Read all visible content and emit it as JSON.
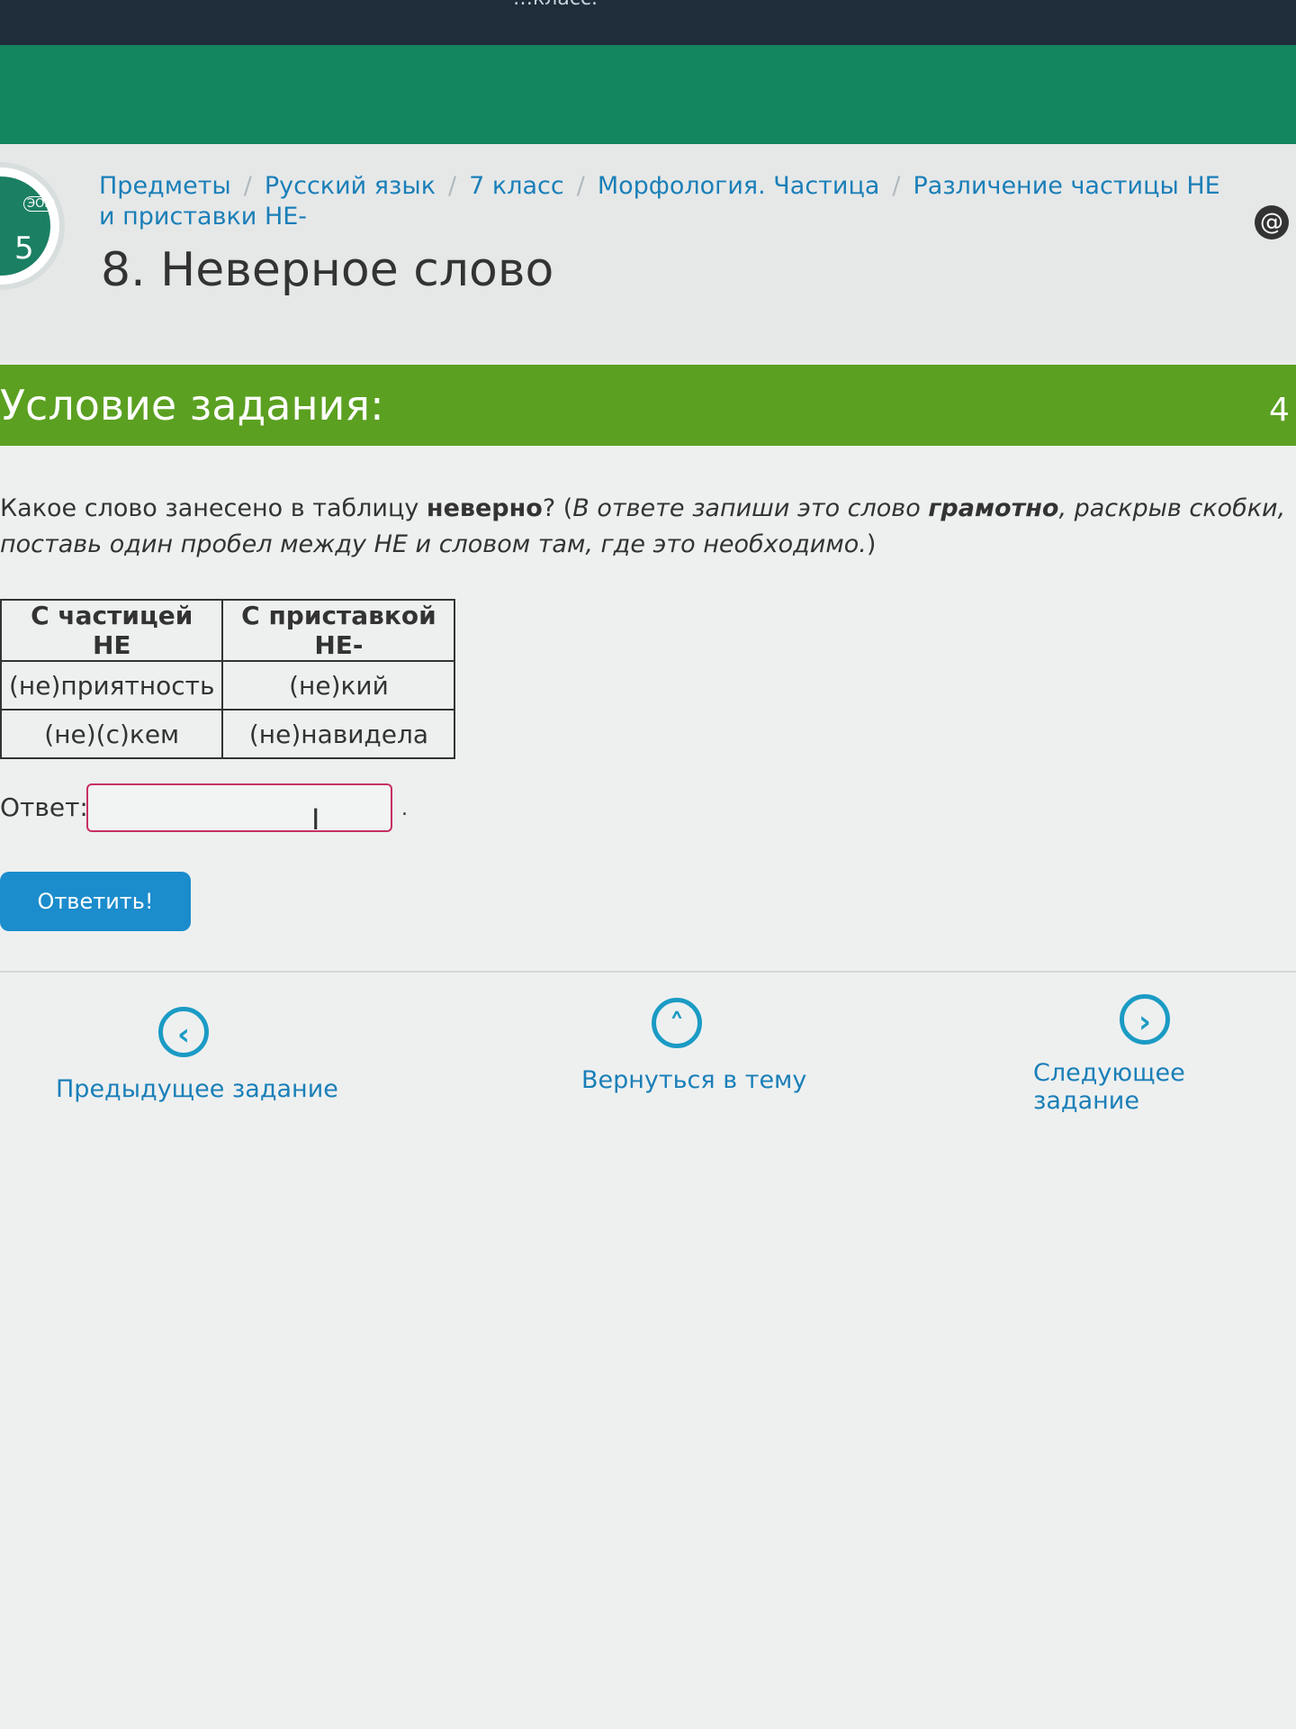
{
  "window": {
    "title_fragment": "…класс."
  },
  "logo": {
    "text": "ЭОР",
    "number": "5"
  },
  "breadcrumb": {
    "items": [
      "Предметы",
      "Русский язык",
      "7 класс",
      "Морфология. Частица",
      "Различение частицы НЕ и приставки НЕ-"
    ],
    "separator": "/"
  },
  "page": {
    "title": "8. Неверное слово"
  },
  "task": {
    "header": "Условие задания:",
    "points": "4",
    "question_prefix": "Какое слово занесено в таблицу ",
    "question_bold": "неверно",
    "question_mark": "? (",
    "instruction_1": "В ответе запиши это слово ",
    "instruction_bold": "грамотно",
    "instruction_2": ", раскрыв скобки, поставь один пробел между НЕ и словом там, где это необходимо.",
    "close_paren": ")"
  },
  "table": {
    "headers": [
      "С частицей НЕ",
      "С приставкой НЕ-"
    ],
    "rows": [
      [
        "(не)приятность",
        "(не)кий"
      ],
      [
        "(не)(с)кем",
        "(не)навидела"
      ]
    ]
  },
  "answer": {
    "label": "Ответ:",
    "value": "",
    "dot": "."
  },
  "buttons": {
    "submit": "Ответить!"
  },
  "navigation": {
    "prev": "Предыдущее задание",
    "back": "Вернуться в тему",
    "next": "Следующее задание"
  },
  "colors": {
    "top_green": "#13855f",
    "task_bar_green": "#5ba021",
    "link_blue": "#1a7fb8",
    "button_blue": "#1b8ccc",
    "input_border": "#c7305f"
  },
  "icons": {
    "prev": "chevron-left-icon",
    "back": "chevron-up-icon",
    "next": "chevron-right-icon",
    "at": "at-icon",
    "cursor": "text-cursor-icon"
  }
}
